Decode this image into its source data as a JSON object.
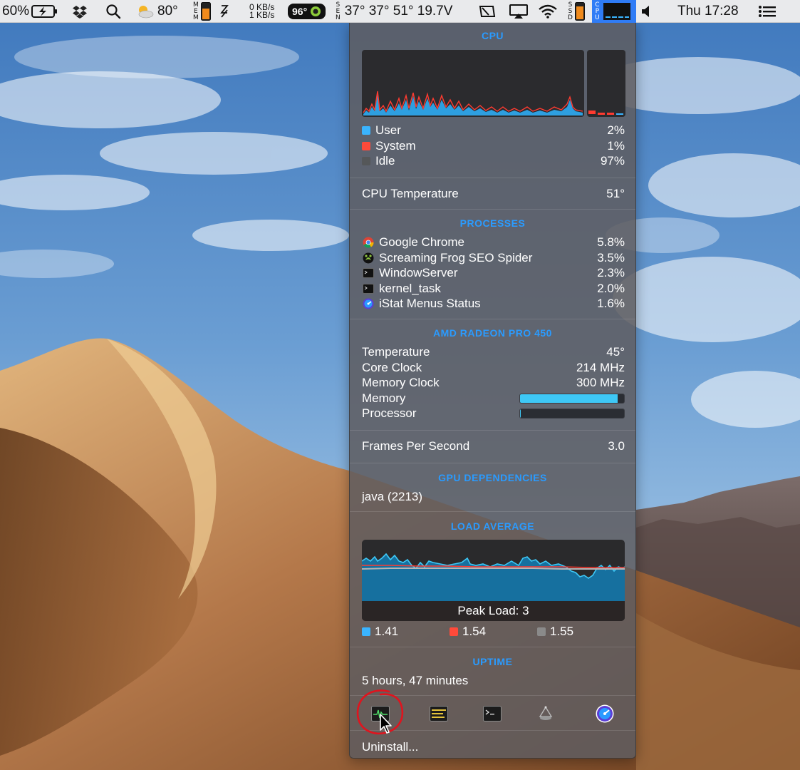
{
  "menubar": {
    "battery_percent": "60%",
    "weather_temp": "80°",
    "mem_label": [
      "M",
      "E",
      "M"
    ],
    "net_up": "0 KB/s",
    "net_down": "1 KB/s",
    "temp_pill": "96°",
    "sensor_label": [
      "S",
      "E",
      "N"
    ],
    "sensor_values": "37° 37° 51° 19.7V",
    "ssd_label": [
      "S",
      "S",
      "D"
    ],
    "cpu_label": [
      "C",
      "P",
      "U"
    ],
    "clock": "Thu 17:28"
  },
  "cpu": {
    "title": "CPU",
    "user_label": "User",
    "user_value": "2%",
    "system_label": "System",
    "system_value": "1%",
    "idle_label": "Idle",
    "idle_value": "97%",
    "temp_label": "CPU Temperature",
    "temp_value": "51°",
    "colors": {
      "user": "#3ab4ff",
      "system": "#ff4a3a",
      "idle": "#555759"
    }
  },
  "processes": {
    "title": "PROCESSES",
    "items": [
      {
        "name": "Google Chrome",
        "value": "5.8%",
        "icon": "chrome-icon"
      },
      {
        "name": "Screaming Frog SEO Spider",
        "value": "3.5%",
        "icon": "frog-icon"
      },
      {
        "name": "WindowServer",
        "value": "2.3%",
        "icon": "terminal-icon"
      },
      {
        "name": "kernel_task",
        "value": "2.0%",
        "icon": "terminal-icon"
      },
      {
        "name": "iStat Menus Status",
        "value": "1.6%",
        "icon": "istat-icon"
      }
    ]
  },
  "gpu": {
    "title": "AMD RADEON PRO 450",
    "temperature_label": "Temperature",
    "temperature_value": "45°",
    "core_label": "Core Clock",
    "core_value": "214 MHz",
    "mem_clock_label": "Memory Clock",
    "mem_clock_value": "300 MHz",
    "memory_label": "Memory",
    "memory_fraction": 0.94,
    "processor_label": "Processor",
    "processor_fraction": 0.01,
    "fps_label": "Frames Per Second",
    "fps_value": "3.0"
  },
  "gpu_dependencies": {
    "title": "GPU DEPENDENCIES",
    "items": [
      "java (2213)"
    ]
  },
  "load_average": {
    "title": "LOAD AVERAGE",
    "peak_label": "Peak Load: 3",
    "values": [
      {
        "value": "1.41",
        "color": "#3ab4ff"
      },
      {
        "value": "1.54",
        "color": "#ff4a3a"
      },
      {
        "value": "1.55",
        "color": "#8a8a8a"
      }
    ]
  },
  "uptime": {
    "title": "UPTIME",
    "value": "5 hours, 47 minutes"
  },
  "toolbar": {
    "icons": [
      "activity-monitor-icon",
      "console-icon",
      "terminal-icon",
      "disk-utility-icon",
      "istat-icon"
    ]
  },
  "footer": {
    "uninstall_label": "Uninstall..."
  }
}
